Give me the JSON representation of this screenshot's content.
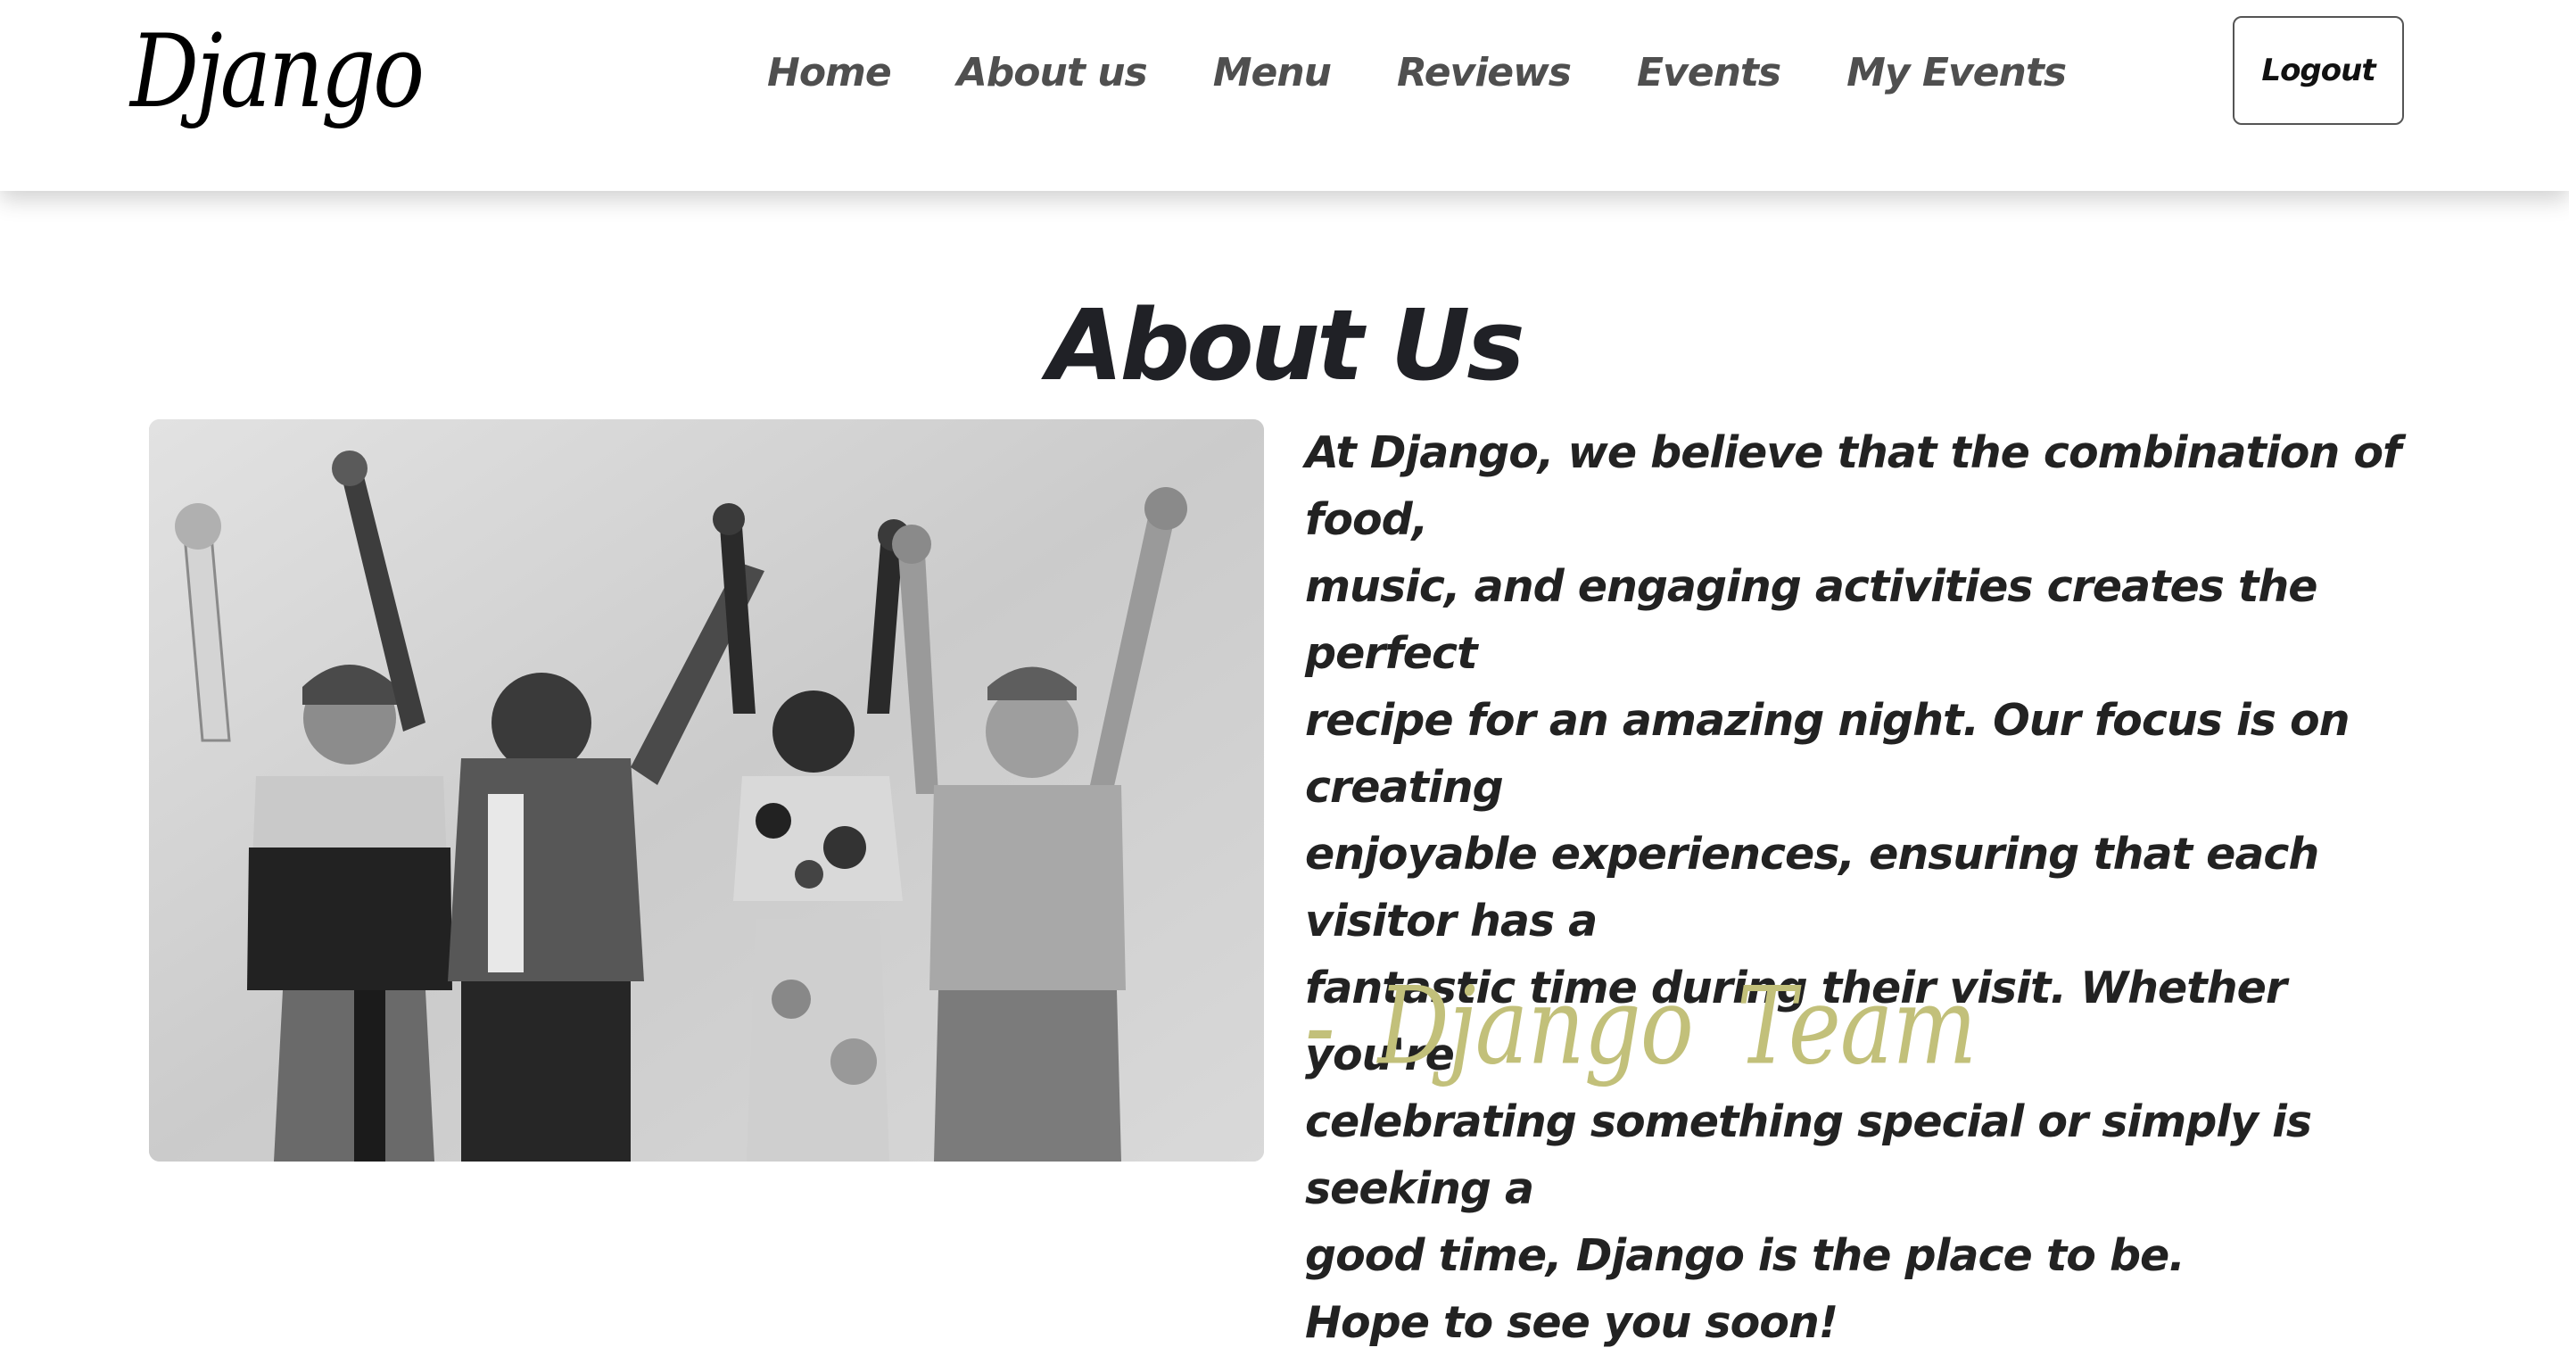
{
  "header": {
    "brand": "Django",
    "nav": {
      "home": "Home",
      "about": "About us",
      "menu": "Menu",
      "reviews": "Reviews",
      "events": "Events",
      "my_events": "My Events"
    },
    "logout_label": "Logout"
  },
  "main": {
    "title": "About Us",
    "body_lines": [
      "At Django, we believe that the combination of food,",
      "music, and engaging activities creates the perfect",
      "recipe for an amazing night. Our focus is on creating",
      "enjoyable experiences, ensuring that each visitor has a",
      "fantastic time during their visit. Whether you're",
      "celebrating something special or simply is seeking a",
      "good time, Django is the place to be.",
      "Hope to see you soon!"
    ],
    "signature": "- Django Team",
    "photo": {
      "description": "four-people-celebrating-photo",
      "style": "black-and-white"
    }
  },
  "colors": {
    "signature": "#c2c07a",
    "nav_text": "#4f4f4f",
    "title_text": "#202126"
  }
}
